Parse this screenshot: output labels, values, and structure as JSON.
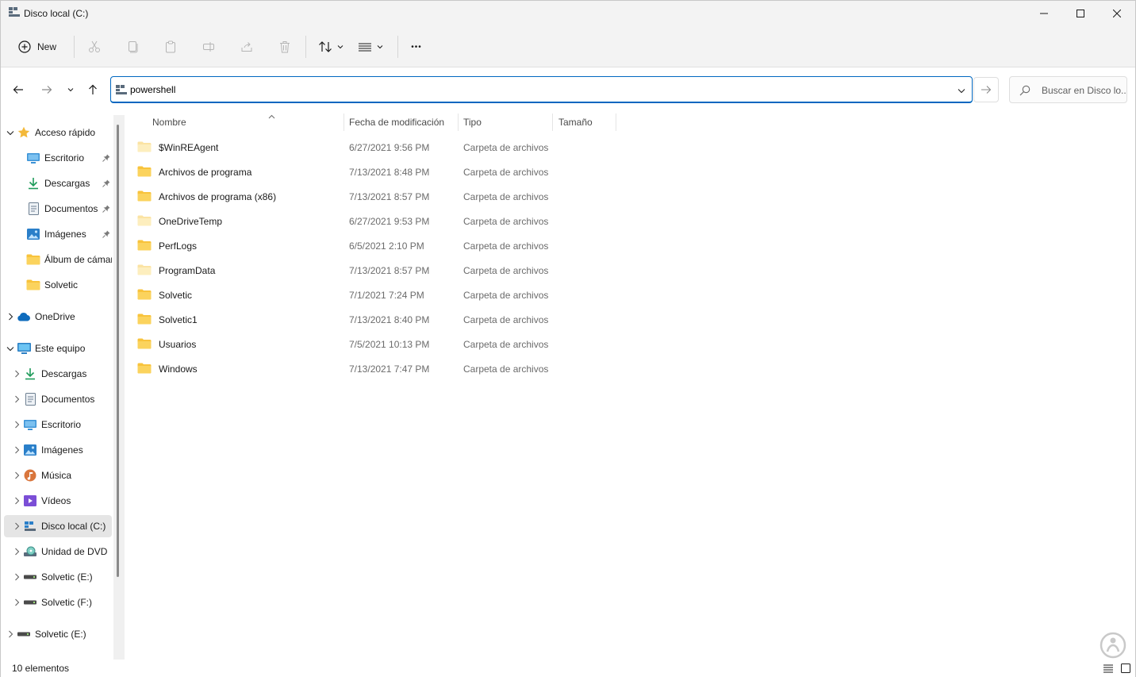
{
  "window": {
    "title": "Disco local (C:)"
  },
  "toolbar": {
    "new_label": "New",
    "more_label": "•••"
  },
  "address": {
    "value": "powershell"
  },
  "search": {
    "placeholder": "Buscar en Disco lo..."
  },
  "sidebar": {
    "quick_access": {
      "label": "Acceso rápido",
      "items": [
        {
          "label": "Escritorio",
          "icon": "desktop-icon",
          "pinned": true
        },
        {
          "label": "Descargas",
          "icon": "download-icon",
          "pinned": true
        },
        {
          "label": "Documentos",
          "icon": "document-icon",
          "pinned": true
        },
        {
          "label": "Imágenes",
          "icon": "pictures-icon",
          "pinned": true
        },
        {
          "label": "Álbum de cámara",
          "icon": "folder-icon",
          "pinned": false
        },
        {
          "label": "Solvetic",
          "icon": "folder-icon",
          "pinned": false
        }
      ]
    },
    "onedrive": {
      "label": "OneDrive"
    },
    "this_pc": {
      "label": "Este equipo",
      "items": [
        {
          "label": "Descargas",
          "icon": "download-icon"
        },
        {
          "label": "Documentos",
          "icon": "document-icon"
        },
        {
          "label": "Escritorio",
          "icon": "desktop-icon"
        },
        {
          "label": "Imágenes",
          "icon": "pictures-icon"
        },
        {
          "label": "Música",
          "icon": "music-icon"
        },
        {
          "label": "Vídeos",
          "icon": "videos-icon"
        },
        {
          "label": "Disco local (C:)",
          "icon": "drive-icon",
          "selected": true
        },
        {
          "label": "Unidad de DVD",
          "icon": "dvd-icon"
        },
        {
          "label": "Solvetic (E:)",
          "icon": "usb-drive-icon"
        },
        {
          "label": "Solvetic (F:)",
          "icon": "usb-drive-icon"
        }
      ]
    },
    "external": {
      "label": "Solvetic (E:)"
    }
  },
  "columns": {
    "name": "Nombre",
    "date": "Fecha de modificación",
    "type": "Tipo",
    "size": "Tamaño"
  },
  "files": [
    {
      "name": "$WinREAgent",
      "date": "6/27/2021 9:56 PM",
      "type": "Carpeta de archivos",
      "faded": true
    },
    {
      "name": "Archivos de programa",
      "date": "7/13/2021 8:48 PM",
      "type": "Carpeta de archivos",
      "faded": false
    },
    {
      "name": "Archivos de programa (x86)",
      "date": "7/13/2021 8:57 PM",
      "type": "Carpeta de archivos",
      "faded": false
    },
    {
      "name": "OneDriveTemp",
      "date": "6/27/2021 9:53 PM",
      "type": "Carpeta de archivos",
      "faded": true
    },
    {
      "name": "PerfLogs",
      "date": "6/5/2021 2:10 PM",
      "type": "Carpeta de archivos",
      "faded": false
    },
    {
      "name": "ProgramData",
      "date": "7/13/2021 8:57 PM",
      "type": "Carpeta de archivos",
      "faded": true
    },
    {
      "name": "Solvetic",
      "date": "7/1/2021 7:24 PM",
      "type": "Carpeta de archivos",
      "faded": false
    },
    {
      "name": "Solvetic1",
      "date": "7/13/2021 8:40 PM",
      "type": "Carpeta de archivos",
      "faded": false
    },
    {
      "name": "Usuarios",
      "date": "7/5/2021 10:13 PM",
      "type": "Carpeta de archivos",
      "faded": false
    },
    {
      "name": "Windows",
      "date": "7/13/2021 7:47 PM",
      "type": "Carpeta de archivos",
      "faded": false
    }
  ],
  "status": {
    "count": "10 elementos"
  },
  "colors": {
    "accent": "#0067c0",
    "folder": "#f8c33c",
    "folder_faded": "#fbe3a3",
    "selected_bg": "#e5e5e5"
  }
}
